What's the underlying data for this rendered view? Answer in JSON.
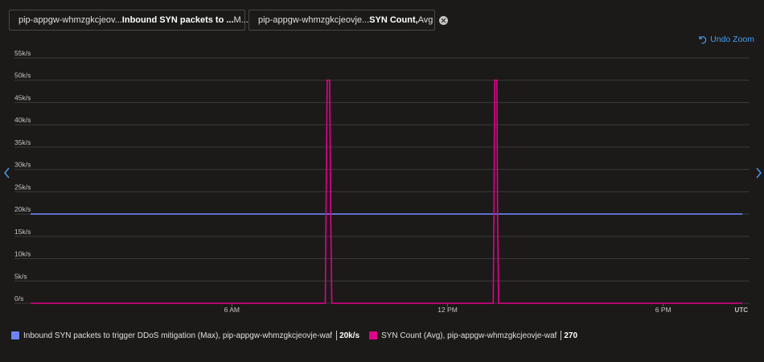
{
  "pills": [
    {
      "prefix": "pip-appgw-whmzgkcjeov...",
      "bold": "Inbound SYN packets to ...",
      "suffix": "M..."
    },
    {
      "prefix": "pip-appgw-whmzgkcjeovje...",
      "bold": "SYN Count,",
      "suffix": "Avg"
    }
  ],
  "undo_zoom_label": "Undo Zoom",
  "colors": {
    "series1": "#6b84f0",
    "series2": "#e3008c",
    "accent": "#479ef5"
  },
  "legend": [
    {
      "label": "Inbound SYN packets to trigger DDoS mitigation (Max), pip-appgw-whmzgkcjeovje-waf",
      "value": "20k/s"
    },
    {
      "label": "SYN Count (Avg), pip-appgw-whmzgkcjeovje-waf",
      "value": "270"
    }
  ],
  "chart_data": {
    "type": "line",
    "y_ticks": [
      "0/s",
      "5k/s",
      "10k/s",
      "15k/s",
      "20k/s",
      "25k/s",
      "30k/s",
      "35k/s",
      "40k/s",
      "45k/s",
      "50k/s",
      "55k/s"
    ],
    "ylim": [
      0,
      55000
    ],
    "x_ticks": [
      {
        "label": "6 AM",
        "hour": 6
      },
      {
        "label": "12 PM",
        "hour": 12
      },
      {
        "label": "6 PM",
        "hour": 18
      }
    ],
    "x_unit_label": "UTC",
    "xlim_hours": [
      0.4,
      20.4
    ],
    "grid": true,
    "series": [
      {
        "name": "Inbound SYN packets to trigger DDoS mitigation (Max), pip-appgw-whmzgkcjeovje-waf",
        "points": [
          [
            0.4,
            20000
          ],
          [
            20.2,
            20000
          ]
        ]
      },
      {
        "name": "SYN Count (Avg), pip-appgw-whmzgkcjeovje-waf",
        "points": [
          [
            0.4,
            0
          ],
          [
            8.6,
            0
          ],
          [
            8.62,
            20000
          ],
          [
            8.65,
            50000
          ],
          [
            8.72,
            50000
          ],
          [
            8.75,
            20000
          ],
          [
            8.78,
            0
          ],
          [
            13.27,
            0
          ],
          [
            13.29,
            20000
          ],
          [
            13.31,
            50000
          ],
          [
            13.37,
            50000
          ],
          [
            13.39,
            20000
          ],
          [
            13.42,
            0
          ],
          [
            20.2,
            0
          ]
        ]
      }
    ]
  }
}
